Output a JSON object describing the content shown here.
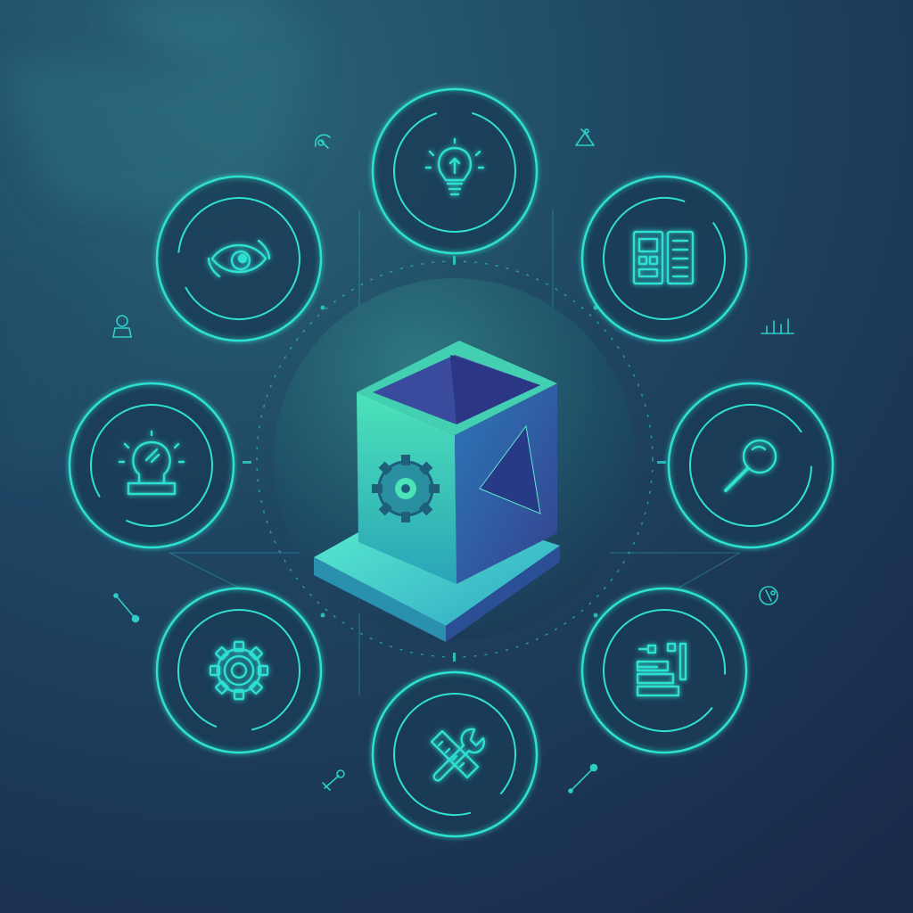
{
  "colors": {
    "background_top": "#23516a",
    "background_bottom": "#1a2c4d",
    "accent": "#2fe0d2",
    "accent_glow": "#1fb8c0",
    "ring_fill": "#173a55",
    "hub_fill": "#1f5266",
    "cube_light": "#3fd6b4",
    "cube_front": "#2a86b0",
    "cube_dark": "#3a3f8e"
  },
  "hub": {
    "icon": "isometric-cube-gear-icon"
  },
  "nodes": [
    {
      "icon": "lightbulb-idea-icon"
    },
    {
      "icon": "document-blueprint-icon"
    },
    {
      "icon": "magnifying-glass-icon"
    },
    {
      "icon": "checklist-document-icon"
    },
    {
      "icon": "wrench-ruler-icon"
    },
    {
      "icon": "gear-settings-icon"
    },
    {
      "icon": "head-idea-icon"
    },
    {
      "icon": "eye-cycle-icon"
    }
  ],
  "decorations": [
    {
      "icon": "tool-sketch-icon"
    },
    {
      "icon": "hand-tools-icon"
    },
    {
      "icon": "bar-chart-icon"
    },
    {
      "icon": "compass-badge-icon"
    },
    {
      "icon": "node-connector-icon"
    },
    {
      "icon": "wrench-doodle-icon"
    },
    {
      "icon": "node-connector-icon"
    },
    {
      "icon": "figure-sketch-icon"
    }
  ]
}
